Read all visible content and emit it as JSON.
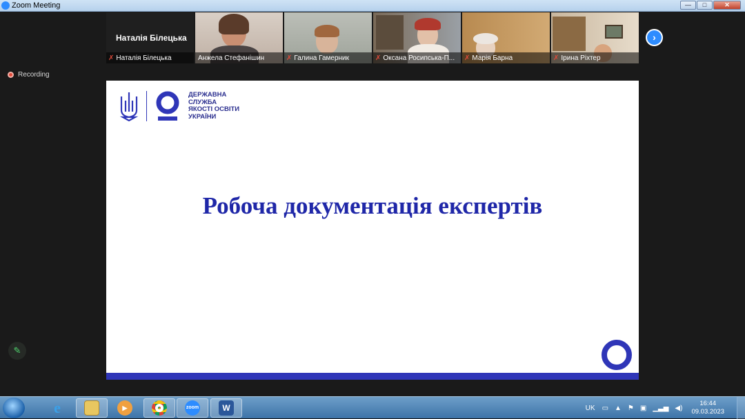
{
  "window": {
    "title": "Zoom Meeting",
    "buttons": {
      "minimize": "—",
      "maximize": "□",
      "close": "✕"
    }
  },
  "recording": {
    "label": "Recording"
  },
  "gallery": {
    "tiles": [
      {
        "display_name": "Наталія Білецька",
        "label": "Наталія Білецька",
        "muted": true,
        "video": false
      },
      {
        "label": "Анжела Стефанішин",
        "muted": false,
        "video": true
      },
      {
        "label": "Галина Гамерник",
        "muted": true,
        "video": true
      },
      {
        "label": "Оксана Росипська-П...",
        "muted": true,
        "video": true
      },
      {
        "label": "Марія Барна",
        "muted": true,
        "video": true
      },
      {
        "label": "Ірина Ріхтер",
        "muted": true,
        "video": true
      }
    ],
    "next_icon": "chevron-right-icon"
  },
  "slide": {
    "logo_text": [
      "ДЕРЖАВНА",
      "СЛУЖБА",
      "ЯКОСТІ ОСВІТИ",
      "УКРАЇНИ"
    ],
    "title": "Робоча документація експертів",
    "accent_color": "#2f36b8"
  },
  "taskbar": {
    "apps": [
      "internet-explorer-icon",
      "folder-icon",
      "media-player-icon",
      "chrome-icon",
      "zoom-icon",
      "word-icon"
    ],
    "zoom_label": "zoom",
    "word_label": "W",
    "language": "UK",
    "time": "16:44",
    "date": "09.03.2023"
  }
}
